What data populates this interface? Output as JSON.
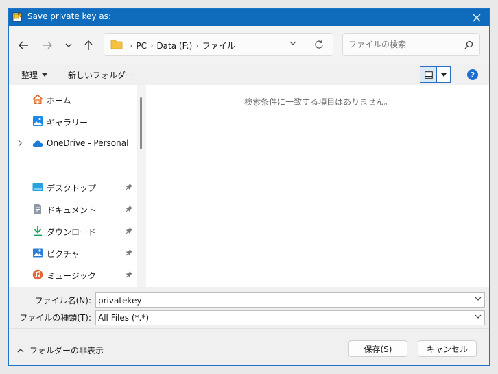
{
  "window": {
    "title": "Save private key as:"
  },
  "nav": {
    "breadcrumb": [
      "PC",
      "Data (F:)",
      "ファイル"
    ],
    "search_placeholder": "ファイルの検索"
  },
  "toolbar": {
    "organize_label": "整理",
    "new_folder_label": "新しいフォルダー"
  },
  "sidebar": {
    "items": [
      {
        "label": "ホーム",
        "icon": "home-icon"
      },
      {
        "label": "ギャラリー",
        "icon": "gallery-icon"
      },
      {
        "label": "OneDrive - Personal",
        "icon": "onedrive-icon"
      },
      {
        "label": "デスクトップ",
        "icon": "desktop-icon"
      },
      {
        "label": "ドキュメント",
        "icon": "documents-icon"
      },
      {
        "label": "ダウンロード",
        "icon": "downloads-icon"
      },
      {
        "label": "ピクチャ",
        "icon": "pictures-icon"
      },
      {
        "label": "ミュージック",
        "icon": "music-icon"
      }
    ]
  },
  "content": {
    "empty_message": "検索条件に一致する項目はありません。"
  },
  "form": {
    "filename_label": "ファイル名(N):",
    "filename_value": "privatekey",
    "filetype_label": "ファイルの種類(T):",
    "filetype_value": "All Files (*.*)"
  },
  "footer": {
    "hide_folders_label": "フォルダーの非表示",
    "save_label": "保存(S)",
    "cancel_label": "キャンセル"
  },
  "colors": {
    "titlebar": "#0f6cbd",
    "accent": "#1c6fd1",
    "help": "#1c6fd1"
  }
}
